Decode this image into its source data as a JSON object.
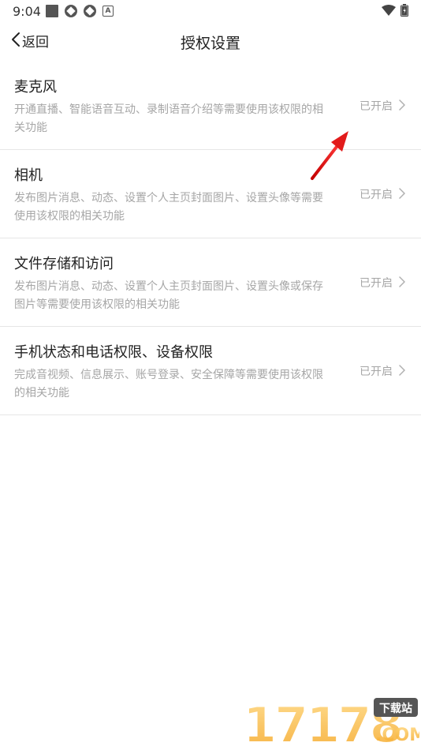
{
  "status_bar": {
    "time": "9:04",
    "icons": [
      "square-icon",
      "app-icon",
      "app-icon",
      "a-icon"
    ],
    "right_icons": [
      "wifi-icon",
      "battery-icon"
    ]
  },
  "header": {
    "back_label": "返回",
    "title": "授权设置"
  },
  "permissions": [
    {
      "title": "麦克风",
      "description": "开通直播、智能语音互动、录制语音介绍等需要使用该权限的相关功能",
      "status": "已开启"
    },
    {
      "title": "相机",
      "description": "发布图片消息、动态、设置个人主页封面图片、设置头像等需要使用该权限的相关功能",
      "status": "已开启"
    },
    {
      "title": "文件存储和访问",
      "description": "发布图片消息、动态、设置个人主页封面图片、设置头像或保存图片等需要使用该权限的相关功能",
      "status": "已开启"
    },
    {
      "title": "手机状态和电话权限、设备权限",
      "description": "完成音视频、信息展示、账号登录、安全保障等需要使用该权限的相关功能",
      "status": "已开启"
    }
  ],
  "watermark": {
    "text": "17178",
    "badge": "下载站",
    "suffix": ".COM"
  },
  "colors": {
    "annotation_arrow": "#e21b1b",
    "secondary_text": "#a6a6a6",
    "divider": "#e6e6e6"
  }
}
